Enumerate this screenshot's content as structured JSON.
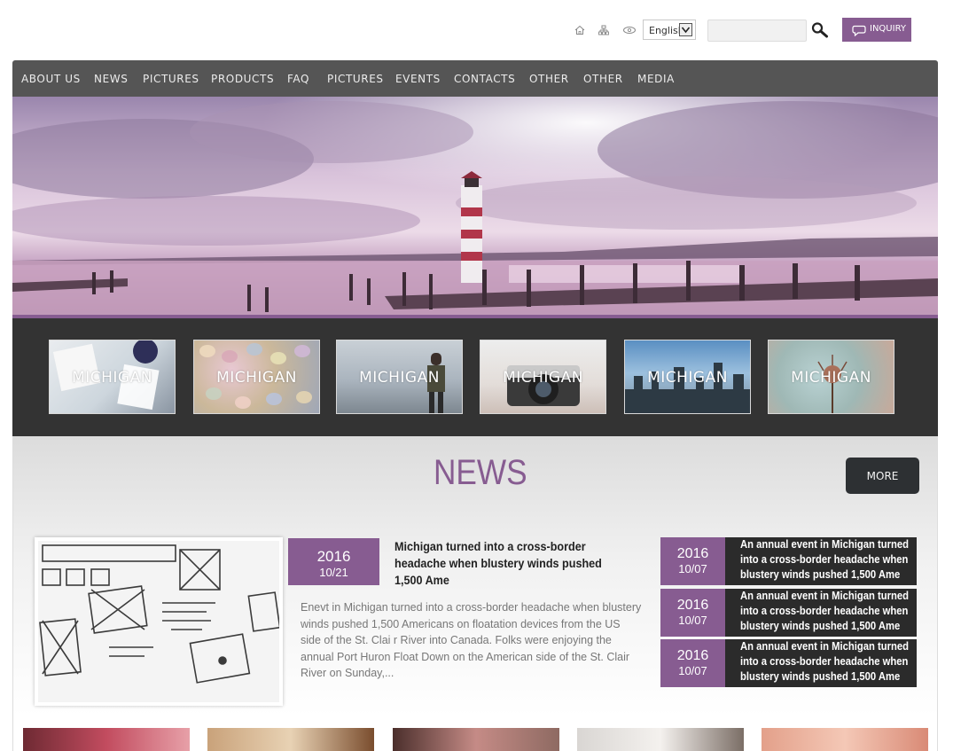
{
  "header": {
    "icons": [
      "home-icon",
      "sitemap-icon",
      "favorite-icon"
    ],
    "language": {
      "selected": "English"
    },
    "search": {
      "placeholder": ""
    },
    "inquiry_label": "INQUIRY"
  },
  "nav": {
    "items": [
      {
        "label": "ABOUT US"
      },
      {
        "label": "NEWS"
      },
      {
        "label": "PICTURES"
      },
      {
        "label": "PRODUCTS"
      },
      {
        "label": "FAQ"
      },
      {
        "label": "PICTURES"
      },
      {
        "label": "EVENTS"
      },
      {
        "label": "CONTACTS"
      },
      {
        "label": "OTHER"
      },
      {
        "label": "OTHER"
      },
      {
        "label": "MEDIA"
      }
    ]
  },
  "thumbnails": [
    {
      "label": "MICHIGAN"
    },
    {
      "label": "MICHIGAN"
    },
    {
      "label": "MICHIGAN"
    },
    {
      "label": "MICHIGAN"
    },
    {
      "label": "MICHIGAN"
    },
    {
      "label": "MICHIGAN"
    }
  ],
  "news": {
    "title": "NEWS",
    "more_label": "MORE",
    "featured": {
      "year": "2016",
      "date": "10/21",
      "headline": "Michigan turned into a cross-border headache when blustery winds pushed 1,500 Ame",
      "body": "Enevt in Michigan turned into a cross-border headache when blustery winds pushed 1,500 Americans on floatation devices from the US side of the St. Clai r River into Canada. Folks were enjoying the annual Port Huron Float Down on the American side of the St. Clair River on Sunday,..."
    },
    "list": [
      {
        "year": "2016",
        "date": "10/07",
        "text": "An annual event in Michigan turned into a cross-border headache when blustery winds pushed 1,500 Ame"
      },
      {
        "year": "2016",
        "date": "10/07",
        "text": "An annual event in Michigan turned into a cross-border headache when blustery winds pushed 1,500 Ame"
      },
      {
        "year": "2016",
        "date": "10/07",
        "text": "An annual event in Michigan turned into a cross-border headache when blustery winds pushed 1,500 Ame"
      }
    ]
  },
  "colors": {
    "accent": "#875c91",
    "nav_bg": "#555555",
    "band_bg": "#333333",
    "dark_box": "#2b2b2b"
  }
}
